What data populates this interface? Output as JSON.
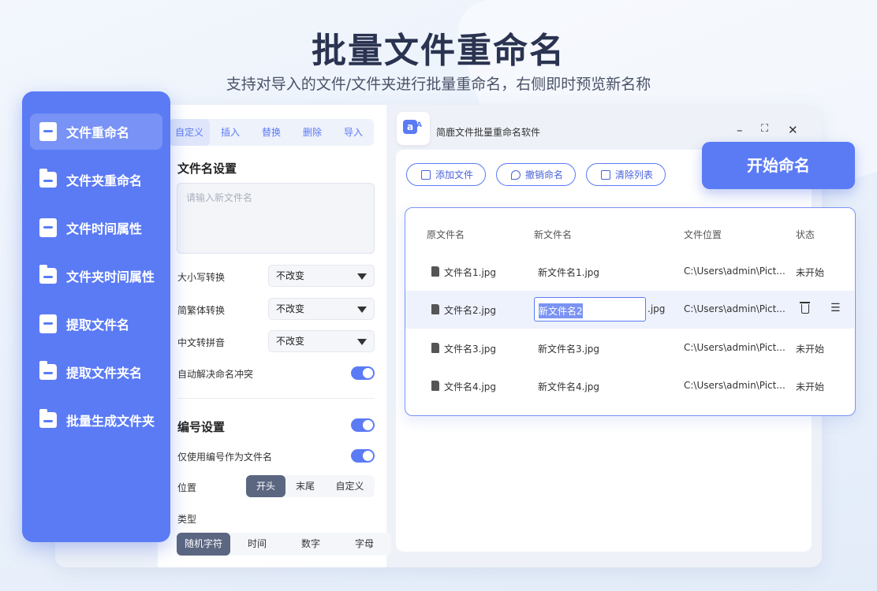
{
  "hero": {
    "title": "批量文件重命名",
    "subtitle": "支持对导入的文件/文件夹进行批量重命名，右侧即时预览新名称"
  },
  "nav": {
    "items": [
      {
        "label": "文件重命名",
        "icon": "file-rename-icon",
        "active": true
      },
      {
        "label": "文件夹重命名",
        "icon": "folder-rename-icon"
      },
      {
        "label": "文件时间属性",
        "icon": "file-time-icon"
      },
      {
        "label": "文件夹时间属性",
        "icon": "folder-time-icon"
      },
      {
        "label": "提取文件名",
        "icon": "extract-file-icon"
      },
      {
        "label": "提取文件夹名",
        "icon": "extract-folder-icon"
      },
      {
        "label": "批量生成文件夹",
        "icon": "create-folder-icon"
      }
    ]
  },
  "tabs": [
    "自定义",
    "插入",
    "替换",
    "删除",
    "导入"
  ],
  "settings": {
    "filename_title": "文件名设置",
    "filename_placeholder": "请输入新文件名",
    "case_label": "大小写转换",
    "case_value": "不改变",
    "trad_label": "简繁体转换",
    "trad_value": "不改变",
    "pinyin_label": "中文转拼音",
    "pinyin_value": "不改变",
    "conflict_label": "自动解决命名冲突",
    "numbering_title": "编号设置",
    "only_number_label": "仅使用编号作为文件名",
    "position_label": "位置",
    "position_options": [
      "开头",
      "末尾",
      "自定义"
    ],
    "type_label": "类型",
    "type_options": [
      "随机字符",
      "时间",
      "数字",
      "字母"
    ]
  },
  "app": {
    "icon_letter": "a",
    "icon_sub": "A",
    "title": "简鹿文件批量重命名软件",
    "minimize": "–",
    "maximize": "⛶",
    "close": "✕"
  },
  "toolbar": {
    "add": "添加文件",
    "undo": "撤销命名",
    "clear": "清除列表",
    "start": "开始命名"
  },
  "table": {
    "headers": [
      "原文件名",
      "新文件名",
      "文件位置",
      "状态"
    ],
    "rows": [
      {
        "orig": "文件名1.jpg",
        "new": "新文件名1.jpg",
        "path": "C:\\Users\\admin\\Pict...",
        "status": "未开始"
      },
      {
        "orig": "文件名2.jpg",
        "new": "新文件名2",
        "ext": ".jpg",
        "path": "C:\\Users\\admin\\Pict...",
        "status": ""
      },
      {
        "orig": "文件名3.jpg",
        "new": "新文件名3.jpg",
        "path": "C:\\Users\\admin\\Pict...",
        "status": "未开始"
      },
      {
        "orig": "文件名4.jpg",
        "new": "新文件名4.jpg",
        "path": "C:\\Users\\admin\\Pict...",
        "status": "未开始"
      }
    ]
  },
  "colors": {
    "accent": "#5b7bf5",
    "dark": "#2a3350",
    "segment_active": "#5b6681"
  }
}
